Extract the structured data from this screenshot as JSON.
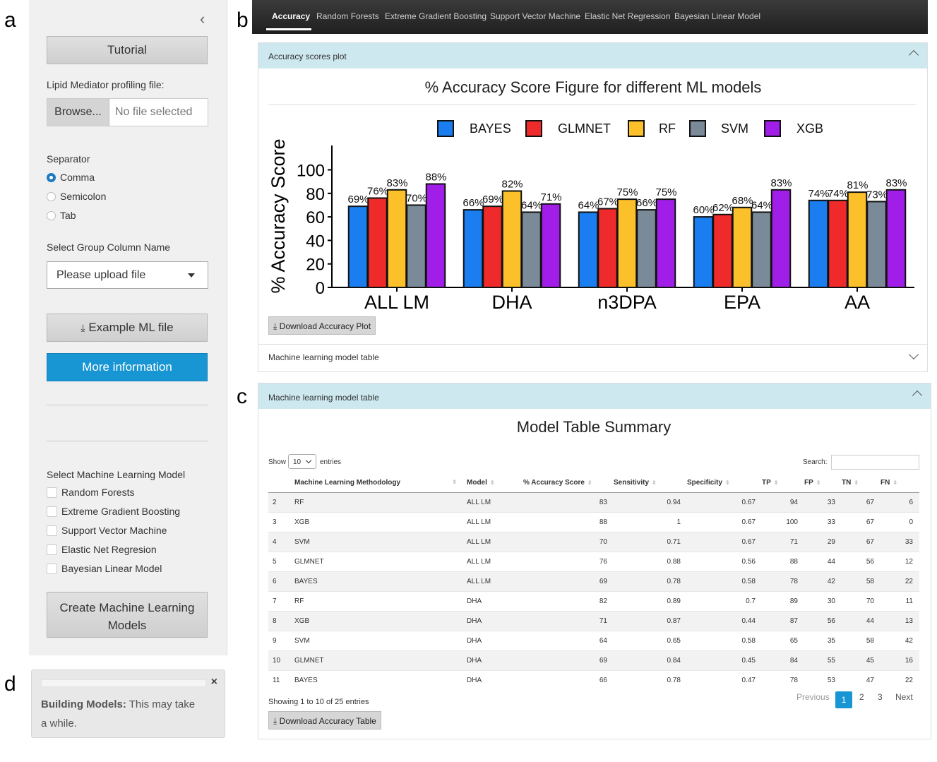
{
  "letters": {
    "a": "a",
    "b": "b",
    "c": "c",
    "d": "d"
  },
  "sidebar": {
    "collapse_glyph": "‹",
    "tutorial": "Tutorial",
    "file_label": "Lipid Mediator profiling file:",
    "browse": "Browse...",
    "no_file": "No file selected",
    "separator_label": "Separator",
    "separators": [
      "Comma",
      "Semicolon",
      "Tab"
    ],
    "group_label": "Select Group Column Name",
    "group_value": "Please upload file",
    "example_btn": "Example ML file",
    "more_info": "More information",
    "model_select_label": "Select Machine Learning Model",
    "models": [
      "Random Forests",
      "Extreme Gradient Boosting",
      "Support Vector Machine",
      "Elastic Net Regresion",
      "Bayesian Linear Model"
    ],
    "create_btn_line1": "Create Machine Learning",
    "create_btn_line2": "Models"
  },
  "notification": {
    "title": "Building Models:",
    "text_line1": "This may take",
    "text_line2": "a while.",
    "close": "×"
  },
  "navbar": {
    "tabs": [
      "Accuracy",
      "Random Forests",
      "Extreme Gradient Boosting",
      "Support Vector Machine",
      "Elastic Net Regression",
      "Bayesian Linear Model"
    ]
  },
  "accuracy_box": {
    "header": "Accuracy scores plot",
    "download": "Download Accuracy Plot",
    "collapsed_header": "Machine learning model table"
  },
  "colors": {
    "BAYES": "#1a7ef0",
    "GLMNET": "#ee2a2a",
    "RF": "#fcc02a",
    "SVM": "#7a8a99",
    "XGB": "#a01ee8",
    "accent": "#1895d3"
  },
  "chart_data": {
    "type": "bar",
    "title": "% Accuracy Score Figure for different ML models",
    "ylabel": "% Accuracy Score",
    "xlabel": "",
    "ylim": [
      0,
      100
    ],
    "yticks": [
      0,
      20,
      40,
      60,
      80,
      100
    ],
    "categories": [
      "ALL LM",
      "DHA",
      "n3DPA",
      "EPA",
      "AA"
    ],
    "legend_position": "top",
    "series": [
      {
        "name": "BAYES",
        "values": [
          69,
          66,
          64,
          60,
          74
        ]
      },
      {
        "name": "GLMNET",
        "values": [
          76,
          69,
          67,
          62,
          74
        ]
      },
      {
        "name": "RF",
        "values": [
          83,
          82,
          75,
          68,
          81
        ]
      },
      {
        "name": "SVM",
        "values": [
          70,
          64,
          66,
          64,
          73
        ]
      },
      {
        "name": "XGB",
        "values": [
          88,
          71,
          75,
          83,
          83
        ]
      }
    ]
  },
  "table_box": {
    "header": "Machine learning model table",
    "title": "Model Table Summary",
    "show": "Show",
    "entries_value": "10",
    "entries": "entries",
    "search": "Search:",
    "columns": [
      "",
      "Machine Learning Methodology",
      "Model",
      "% Accuracy Score",
      "Sensitivity",
      "Specificity",
      "TP",
      "FP",
      "TN",
      "FN"
    ],
    "rows": [
      [
        "2",
        "RF",
        "ALL LM",
        "83",
        "0.94",
        "0.67",
        "94",
        "33",
        "67",
        "6"
      ],
      [
        "3",
        "XGB",
        "ALL LM",
        "88",
        "1",
        "0.67",
        "100",
        "33",
        "67",
        "0"
      ],
      [
        "4",
        "SVM",
        "ALL LM",
        "70",
        "0.71",
        "0.67",
        "71",
        "29",
        "67",
        "33"
      ],
      [
        "5",
        "GLMNET",
        "ALL LM",
        "76",
        "0.88",
        "0.56",
        "88",
        "44",
        "56",
        "12"
      ],
      [
        "6",
        "BAYES",
        "ALL LM",
        "69",
        "0.78",
        "0.58",
        "78",
        "42",
        "58",
        "22"
      ],
      [
        "7",
        "RF",
        "DHA",
        "82",
        "0.89",
        "0.7",
        "89",
        "30",
        "70",
        "11"
      ],
      [
        "8",
        "XGB",
        "DHA",
        "71",
        "0.87",
        "0.44",
        "87",
        "56",
        "44",
        "13"
      ],
      [
        "9",
        "SVM",
        "DHA",
        "64",
        "0.65",
        "0.58",
        "65",
        "35",
        "58",
        "42"
      ],
      [
        "10",
        "GLMNET",
        "DHA",
        "69",
        "0.84",
        "0.45",
        "84",
        "55",
        "45",
        "16"
      ],
      [
        "11",
        "BAYES",
        "DHA",
        "66",
        "0.78",
        "0.47",
        "78",
        "53",
        "47",
        "22"
      ]
    ],
    "info": "Showing 1 to 10 of 25 entries",
    "previous": "Previous",
    "pages": [
      "1",
      "2",
      "3"
    ],
    "next": "Next",
    "download": "Download Accuracy Table"
  }
}
